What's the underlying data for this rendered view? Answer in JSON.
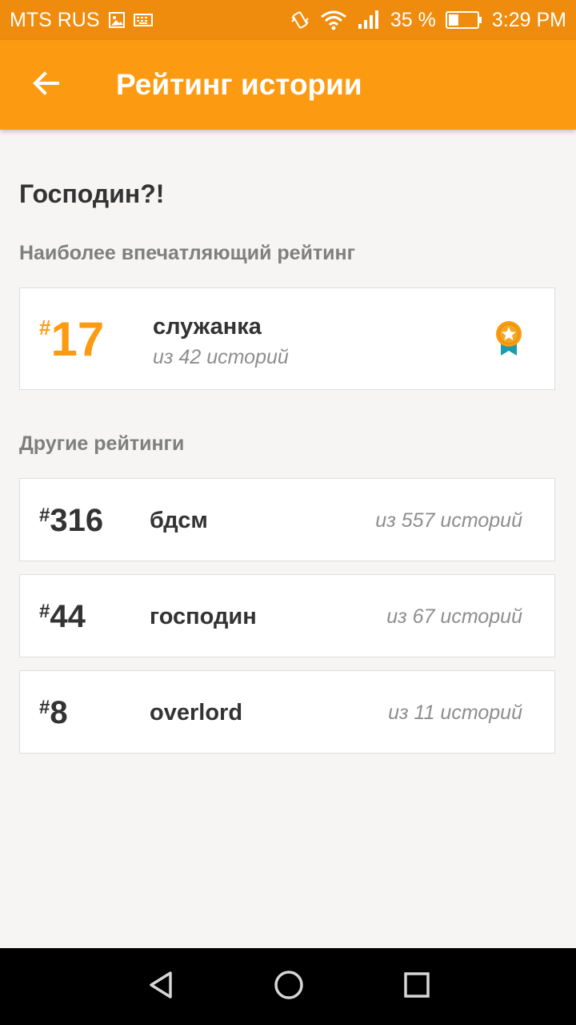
{
  "status_bar": {
    "carrier": "MTS RUS",
    "battery_percent": "35 %",
    "battery_level": 0.35,
    "time": "3:29 PM",
    "icons": [
      "image-icon",
      "keyboard-icon",
      "vibrate-icon",
      "wifi-icon",
      "signal-icon",
      "battery-icon"
    ]
  },
  "app_bar": {
    "title": "Рейтинг истории",
    "back_icon": "arrow-left-icon"
  },
  "story_title": "Господин?!",
  "featured": {
    "section_label": "Наиболее впечатляющий рейтинг",
    "hash": "#",
    "rank": "17",
    "tag": "служанка",
    "count": "из 42 историй",
    "badge_icon": "award-ribbon-icon"
  },
  "others": {
    "section_label": "Другие рейтинги",
    "items": [
      {
        "hash": "#",
        "rank": "316",
        "tag": "бдсм",
        "count": "из 557 историй"
      },
      {
        "hash": "#",
        "rank": "44",
        "tag": "господин",
        "count": "из 67 историй"
      },
      {
        "hash": "#",
        "rank": "8",
        "tag": "overlord",
        "count": "из 11 историй"
      }
    ]
  },
  "nav_bar": {
    "icons": [
      "back-triangle-icon",
      "home-circle-icon",
      "recents-square-icon"
    ]
  },
  "colors": {
    "accent": "#fc9b12",
    "status_bar": "#ef8c0e",
    "text_dark": "#333333",
    "text_muted": "#8e8e8e",
    "badge_ribbon": "#1a9bb0"
  }
}
